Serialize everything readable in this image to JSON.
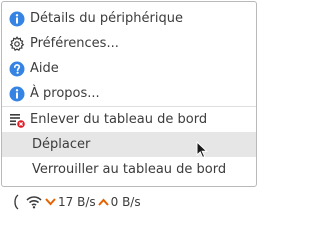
{
  "menu": {
    "items": [
      {
        "label": "Détails du périphérique",
        "icon": "info-icon"
      },
      {
        "label": "Préférences...",
        "icon": "gear-icon"
      },
      {
        "label": "Aide",
        "icon": "help-icon"
      },
      {
        "label": "À propos...",
        "icon": "info-icon"
      },
      {
        "label": "Enlever du tableau de bord",
        "icon": "remove-from-panel-icon"
      },
      {
        "label": "Déplacer",
        "icon": null
      },
      {
        "label": "Verrouiller au tableau de bord",
        "icon": null
      }
    ]
  },
  "panel": {
    "download_speed": "17 B/s",
    "upload_speed": "0 B/s"
  },
  "colors": {
    "info_blue": "#3584e4",
    "download_orange": "#e66100",
    "upload_orange": "#e66100",
    "remove_red": "#e01b24",
    "highlight": "#e6e6e6"
  }
}
